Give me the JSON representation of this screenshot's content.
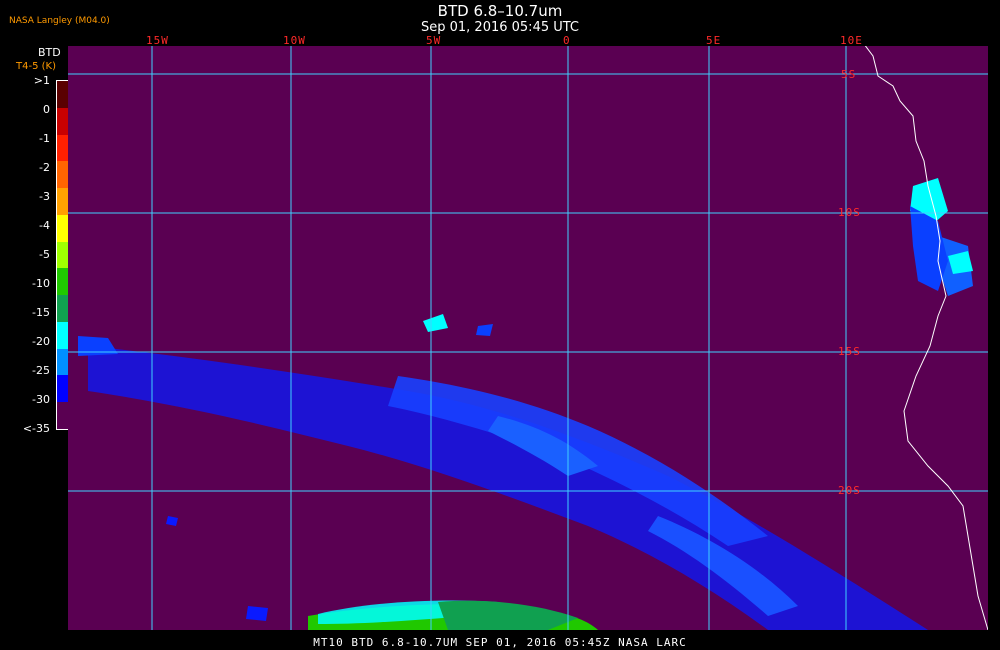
{
  "header": {
    "title": "BTD 6.8–10.7um",
    "subtitle": "Sep 01, 2016 05:45 UTC",
    "source": "NASA Langley (M04.0)"
  },
  "colorbar": {
    "title_line1": "BTD",
    "title_line2": "T4-5 (K)",
    "labels": [
      ">1",
      "0",
      "-1",
      "-2",
      "-3",
      "-4",
      "-5",
      "-10",
      "-15",
      "-20",
      "-25",
      "-30",
      "<-35"
    ],
    "colors": [
      "#5a0000",
      "#c80000",
      "#ff2000",
      "#ff6400",
      "#ffa000",
      "#ffff00",
      "#a0ff00",
      "#20c800",
      "#10a050",
      "#00ffff",
      "#0090ff",
      "#0000ff",
      "#5a0052"
    ]
  },
  "map": {
    "background_color": "#5a0052",
    "grid_color": "#40d0ff",
    "coast_color": "#ffffff",
    "lon_labels": [
      "15W",
      "10W",
      "5W",
      "0",
      "5E",
      "10E"
    ],
    "lat_labels": [
      "5S",
      "10S",
      "15S",
      "20S"
    ]
  },
  "footer": {
    "text": "MT10   BTD 6.8-10.7UM   SEP 01, 2016 05:45Z   NASA LARC"
  }
}
